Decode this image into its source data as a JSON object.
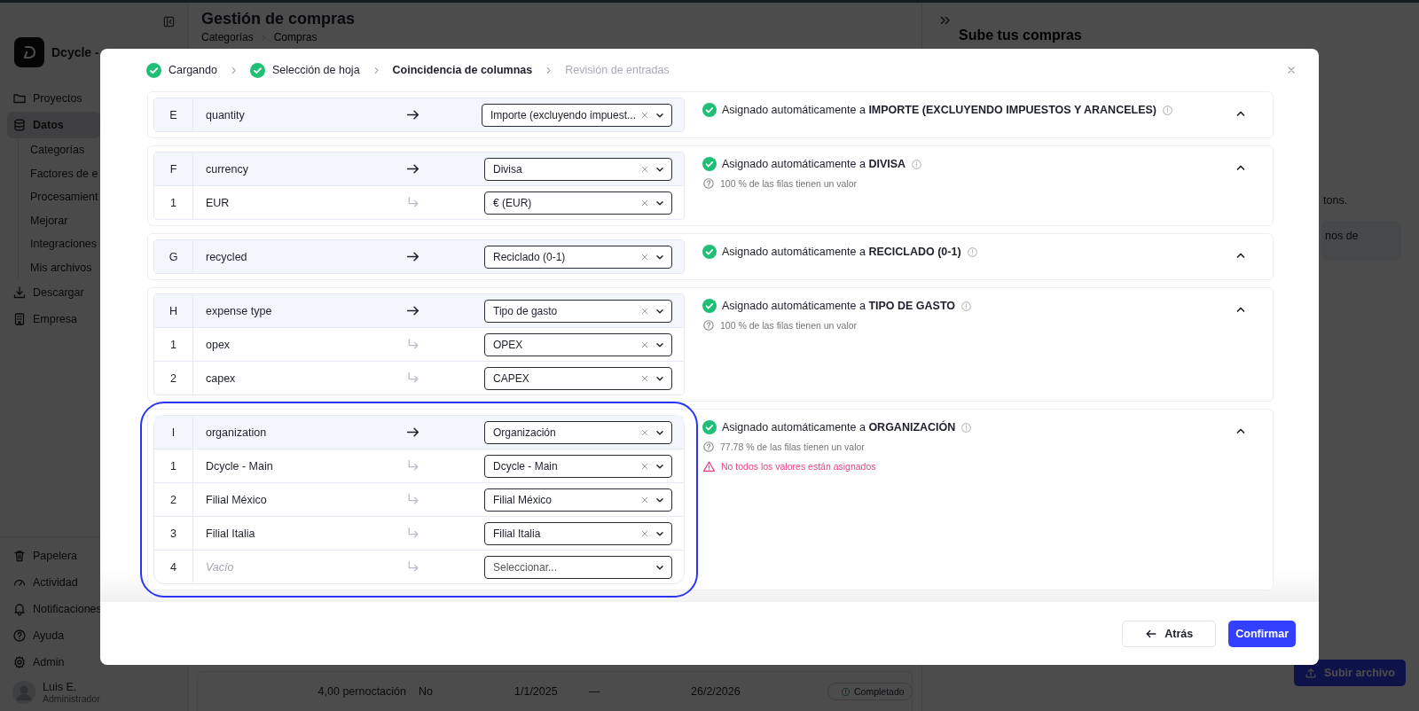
{
  "sidebar": {
    "brand": "Dcycle -",
    "nav": [
      {
        "label": "Proyectos",
        "selected": false
      },
      {
        "label": "Datos",
        "selected": true,
        "children": [
          {
            "label": "Categorías",
            "selected": false
          },
          {
            "label": "Factores de e",
            "selected": false
          },
          {
            "label": "Procesamient",
            "selected": false
          },
          {
            "label": "Mejorar",
            "selected": false
          },
          {
            "label": "Integraciones",
            "selected": false
          },
          {
            "label": "Mis archivos",
            "selected": false
          }
        ]
      },
      {
        "label": "Descargar",
        "selected": false
      },
      {
        "label": "Empresa",
        "selected": false
      }
    ],
    "bottom_nav": [
      {
        "label": "Papelera",
        "selected": false
      },
      {
        "label": "Actividad",
        "selected": false
      },
      {
        "label": "Notificaciones",
        "selected": false
      },
      {
        "label": "Ayuda",
        "selected": false
      },
      {
        "label": "Admin",
        "selected": false
      }
    ],
    "user": {
      "name": "Luis E.",
      "role": "Administrador"
    }
  },
  "main": {
    "title": "Gestión de compras",
    "breadcrumb": [
      "Categorías",
      "Compras"
    ],
    "row": {
      "cells": [
        "4,00 pernoctación",
        "No",
        "1/1/2025",
        "—",
        "26/2/2026"
      ],
      "status": "Completado"
    }
  },
  "right_panel": {
    "title": "Sube tus compras",
    "fragment": "tons.",
    "card_fragment": "nos de",
    "upload_button": "Subir archivo"
  },
  "modal": {
    "steps": [
      {
        "label": "Cargando",
        "done": true,
        "selected": false
      },
      {
        "label": "Selección de hoja",
        "done": true,
        "selected": false
      },
      {
        "label": "Coincidencia de columnas",
        "done": false,
        "selected": true
      },
      {
        "label": "Revisión de entradas",
        "done": false,
        "selected": false
      }
    ],
    "groups": [
      {
        "letter": "E",
        "column": "quantity",
        "target": "Importe (excluyendo impuest...",
        "expanded": true,
        "highlighted": false,
        "message": "Asignado automáticamente a **IMPORTE (EXCLUYENDO IMPUESTOS Y ARANCELES)**"
      },
      {
        "letter": "F",
        "column": "currency",
        "target": "Divisa",
        "expanded": true,
        "highlighted": false,
        "message": "Asignado automáticamente a **DIVISA**",
        "coverage": "100 % de las filas tienen un valor",
        "values": [
          {
            "index": "1",
            "source": "EUR",
            "source_empty": false,
            "value": "€ (EUR)"
          }
        ]
      },
      {
        "letter": "G",
        "column": "recycled",
        "target": "Reciclado (0-1)",
        "expanded": true,
        "highlighted": false,
        "message": "Asignado automáticamente a **RECICLADO (0-1)**"
      },
      {
        "letter": "H",
        "column": "expense type",
        "target": "Tipo de gasto",
        "expanded": true,
        "highlighted": false,
        "message": "Asignado automáticamente a **TIPO DE GASTO**",
        "coverage": "100 % de las filas tienen un valor",
        "values": [
          {
            "index": "1",
            "source": "opex",
            "source_empty": false,
            "value": "OPEX"
          },
          {
            "index": "2",
            "source": "capex",
            "source_empty": false,
            "value": "CAPEX"
          }
        ]
      },
      {
        "letter": "I",
        "column": "organization",
        "target": "Organización",
        "expanded": true,
        "highlighted": true,
        "message": "Asignado automáticamente a **ORGANIZACIÓN**",
        "coverage": "77.78 % de las filas tienen un valor",
        "warning": "No todos los valores están asignados",
        "values": [
          {
            "index": "1",
            "source": "Dcycle - Main",
            "source_empty": false,
            "value": "Dcycle - Main"
          },
          {
            "index": "2",
            "source": "Filial México",
            "source_empty": false,
            "value": "Filial México"
          },
          {
            "index": "3",
            "source": "Filial Italia",
            "source_empty": false,
            "value": "Filial Italia"
          },
          {
            "index": "4",
            "source": "Vacío",
            "source_empty": true,
            "placeholder": "Seleccionar..."
          }
        ]
      }
    ],
    "buttons": {
      "back": "Atrás",
      "confirm": "Confirmar"
    }
  }
}
